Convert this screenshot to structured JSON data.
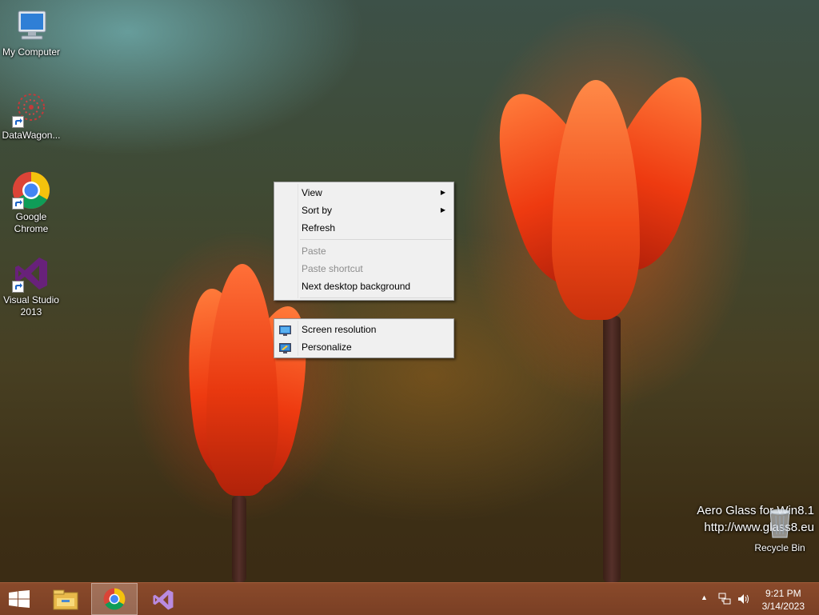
{
  "desktop": {
    "icons": [
      {
        "label": "My Computer"
      },
      {
        "label": "DataWagon..."
      },
      {
        "label": "Google Chrome"
      },
      {
        "label": "Visual Studio 2013"
      },
      {
        "label": "Recycle Bin"
      }
    ],
    "watermark": {
      "line1": "Aero Glass for Win8.1",
      "line2": "http://www.glass8.eu"
    }
  },
  "context_menu": {
    "group1": [
      {
        "label": "View",
        "submenu": true,
        "enabled": true
      },
      {
        "label": "Sort by",
        "submenu": true,
        "enabled": true
      },
      {
        "label": "Refresh",
        "submenu": false,
        "enabled": true
      }
    ],
    "group2": [
      {
        "label": "Paste",
        "enabled": false
      },
      {
        "label": "Paste shortcut",
        "enabled": false
      },
      {
        "label": "Next desktop background",
        "enabled": true
      }
    ],
    "group3": [
      {
        "label": "Screen resolution",
        "icon": "display-settings-icon"
      },
      {
        "label": "Personalize",
        "icon": "personalize-icon"
      }
    ]
  },
  "taskbar": {
    "pinned": [
      "windows-logo-icon",
      "file-explorer-icon",
      "chrome-icon",
      "visual-studio-icon"
    ],
    "active": "chrome-icon",
    "tray_icons": [
      "chevron-up-icon",
      "network-icon",
      "volume-icon"
    ],
    "clock": {
      "time": "9:21 PM",
      "date": "3/14/2023"
    }
  },
  "colors": {
    "taskbar": "#7f4327",
    "menu_bg": "#f0f0f0",
    "flower": "#ee3a10"
  }
}
